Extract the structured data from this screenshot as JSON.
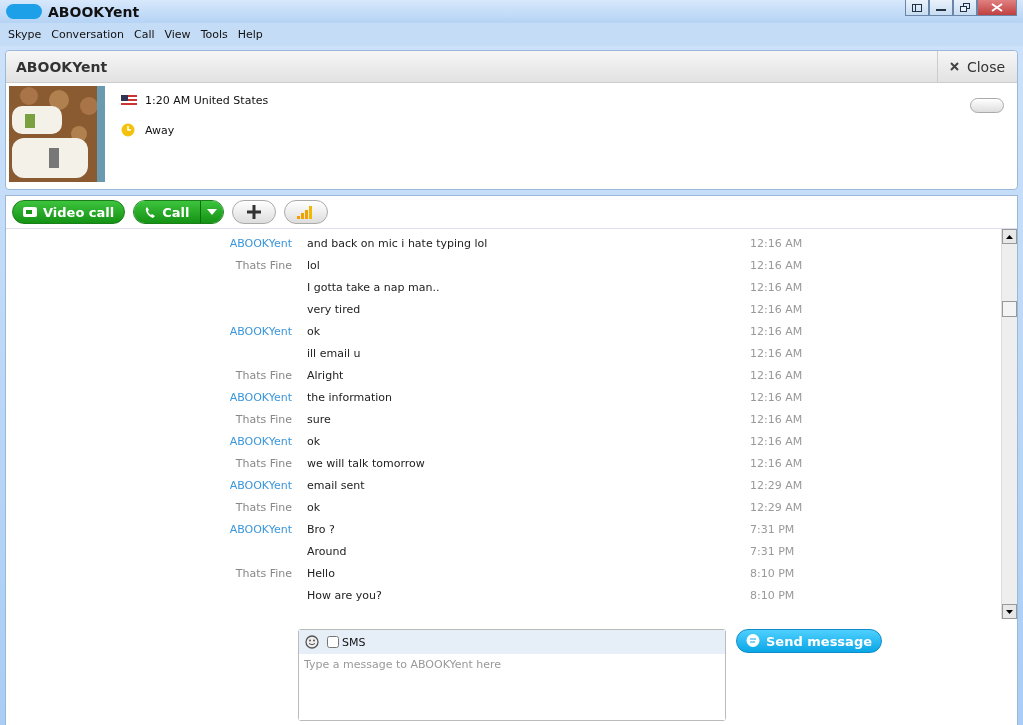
{
  "window": {
    "title": "ABOOKYent"
  },
  "menu": [
    "Skype",
    "Conversation",
    "Call",
    "View",
    "Tools",
    "Help"
  ],
  "contact": {
    "name": "ABOOKYent",
    "close": "Close",
    "local_time": "1:20 AM United States",
    "status": "Away"
  },
  "toolbar": {
    "video_call": "Video call",
    "call": "Call"
  },
  "messages": [
    {
      "sender": "ABOOKYent",
      "kind": "contact",
      "text": "and back on mic i hate typing lol",
      "time": "12:16 AM"
    },
    {
      "sender": "Thats Fine",
      "kind": "self",
      "text": "lol",
      "time": "12:16 AM"
    },
    {
      "text": "I gotta take a nap man..",
      "time": "12:16 AM"
    },
    {
      "text": "very tired",
      "time": "12:16 AM"
    },
    {
      "sender": "ABOOKYent",
      "kind": "contact",
      "text": "ok",
      "time": "12:16 AM"
    },
    {
      "text": "ill email u",
      "time": "12:16 AM"
    },
    {
      "sender": "Thats Fine",
      "kind": "self",
      "text": "Alright",
      "time": "12:16 AM"
    },
    {
      "sender": "ABOOKYent",
      "kind": "contact",
      "text": "the information",
      "time": "12:16 AM"
    },
    {
      "sender": "Thats Fine",
      "kind": "self",
      "text": "sure",
      "time": "12:16 AM"
    },
    {
      "sender": "ABOOKYent",
      "kind": "contact",
      "text": "ok",
      "time": "12:16 AM"
    },
    {
      "sender": "Thats Fine",
      "kind": "self",
      "text": "we will talk tomorrow",
      "time": "12:16 AM"
    },
    {
      "sender": "ABOOKYent",
      "kind": "contact",
      "text": "email sent",
      "time": "12:29 AM"
    },
    {
      "sender": "Thats Fine",
      "kind": "self",
      "text": "ok",
      "time": "12:29 AM"
    },
    {
      "sender": "ABOOKYent",
      "kind": "contact",
      "text": "Bro ?",
      "time": "7:31 PM"
    },
    {
      "text": "Around",
      "time": "7:31 PM"
    },
    {
      "sender": "Thats Fine",
      "kind": "self",
      "text": "Hello",
      "time": "8:10 PM"
    },
    {
      "text": "How are you?",
      "time": "8:10 PM"
    }
  ],
  "compose": {
    "sms": {
      "label": "SMS",
      "checked": false
    },
    "placeholder": "Type a message to ABOOKYent here",
    "send": "Send message"
  }
}
